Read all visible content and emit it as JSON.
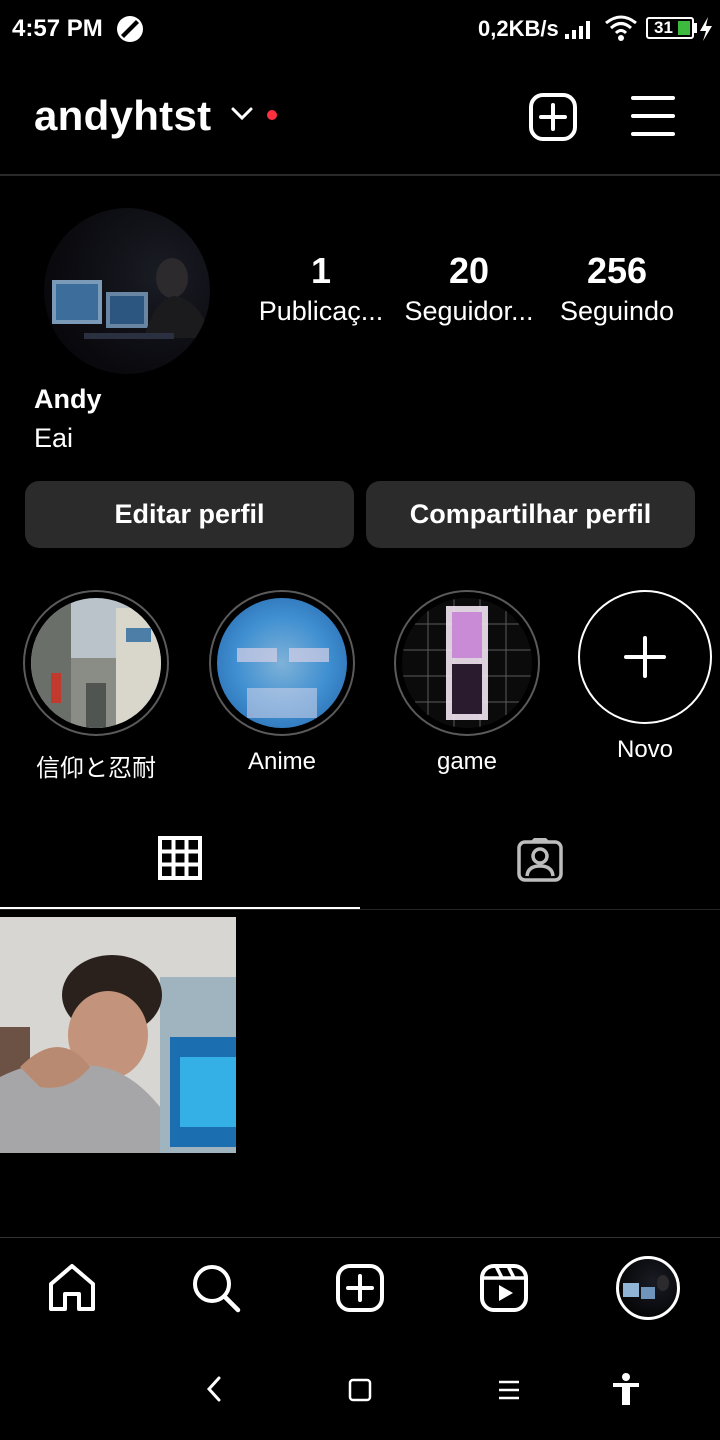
{
  "status_bar": {
    "time": "4:57 PM",
    "network_speed": "0,2KB/s",
    "battery_level": "31",
    "icons": [
      "dnd-circle-icon",
      "signal-icon",
      "wifi-icon",
      "battery-icon",
      "charging-bolt-icon"
    ]
  },
  "header": {
    "username": "andyhtst",
    "icons": [
      "chevron-down-icon",
      "notification-dot",
      "create-post-icon",
      "menu-icon"
    ]
  },
  "profile": {
    "stats": [
      {
        "value": "1",
        "label": "Publicaç..."
      },
      {
        "value": "20",
        "label": "Seguidor..."
      },
      {
        "value": "256",
        "label": "Seguindo"
      }
    ],
    "name": "Andy",
    "bio": "Eai"
  },
  "actions": {
    "edit_label": "Editar perfil",
    "share_label": "Compartilhar perfil"
  },
  "highlights": [
    {
      "label": "信仰と忍耐"
    },
    {
      "label": "Anime"
    },
    {
      "label": "game"
    }
  ],
  "new_highlight_label": "Novo",
  "tabs": [
    "grid-icon",
    "tagged-icon"
  ],
  "bottom_nav": [
    "home-icon",
    "search-icon",
    "create-icon",
    "reels-icon",
    "profile-avatar"
  ],
  "system_nav": [
    "back-icon",
    "home-square-icon",
    "recents-icon",
    "accessibility-icon"
  ],
  "colors": {
    "background": "#000000",
    "button_bg": "#2b2b2b",
    "notification_dot": "#ff3040",
    "battery_fill": "#3dba3d"
  }
}
